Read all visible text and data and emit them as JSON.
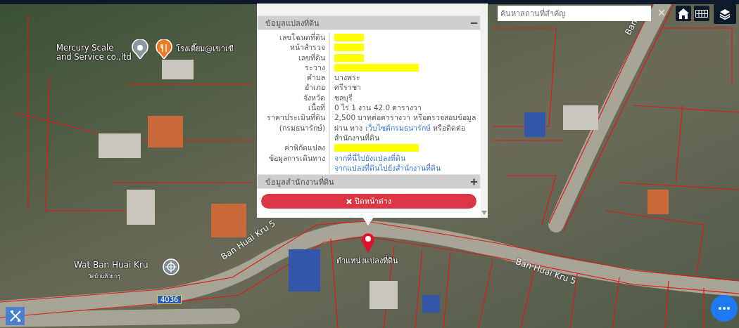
{
  "search": {
    "placeholder": "ค้นหาสถานที่สำคัญ"
  },
  "map_labels": [
    {
      "kind": "place",
      "lines": [
        "Mercury Scale",
        "and Service co.,ltd"
      ]
    },
    {
      "kind": "place",
      "lines": [
        "โรงเตี๊ยม@เขาเขี"
      ]
    },
    {
      "kind": "place",
      "lines": [
        "Wat Ban Huai Kru"
      ]
    },
    {
      "kind": "sub",
      "lines": [
        "วัดบ้านห้วยกรุ"
      ]
    },
    {
      "kind": "road",
      "lines": [
        "Ban Huai Kru 5"
      ]
    },
    {
      "kind": "road",
      "lines": [
        "Ban Huai Kru 5"
      ]
    },
    {
      "kind": "road",
      "lines": [
        "Ban"
      ]
    },
    {
      "kind": "shield",
      "lines": [
        "4036"
      ]
    },
    {
      "kind": "pin",
      "lines": [
        "ตำแหน่งแปลงที่ดิน"
      ]
    }
  ],
  "popup": {
    "sections": [
      {
        "title": "ข้อมูลแปลงที่ดิน",
        "expanded": true,
        "rows": [
          {
            "kind": "redacted",
            "label": "เลขโฉนดที่ดิน"
          },
          {
            "kind": "redacted",
            "label": "หน้าสำรวจ"
          },
          {
            "kind": "redacted",
            "label": "เลขที่ดิน"
          },
          {
            "kind": "redacted",
            "label": "ระวาง"
          },
          {
            "kind": "text",
            "label": "ตำบล",
            "value": "บางพระ"
          },
          {
            "kind": "text",
            "label": "อำเภอ",
            "value": "ศรีราชา"
          },
          {
            "kind": "text",
            "label": "จังหวัด",
            "value": "ชลบุรี"
          },
          {
            "kind": "text",
            "label": "เนื้อที่",
            "value": "0 ไร่ 1 งาน 42.0 ตารางวา"
          },
          {
            "kind": "price",
            "label_lines": [
              "ราคาประเมินที่ดิน",
              "(กรมธนารักษ์)"
            ],
            "before": "2,500 บาทต่อตารางวา หรือตรวจสอบข้อมูลผ่าน ทาง",
            "link": "เว็บไซต์กรมธนารักษ์",
            "after": "หรือติดต่อสำนักงานที่ดิน"
          },
          {
            "kind": "redacted",
            "label": "ค่าพิกัดแปลง"
          },
          {
            "kind": "links",
            "label": "ข้อมูลการเดินทาง",
            "links": [
              "จากที่นี่ไปยังแปลงที่ดิน",
              "จากแปลงที่ดินไปยังสำนักงานที่ดิน"
            ]
          }
        ]
      },
      {
        "title": "ข้อมูลสำนักงานที่ดิน",
        "expanded": false
      }
    ],
    "close_button": "ปิดหน้าต่าง"
  }
}
